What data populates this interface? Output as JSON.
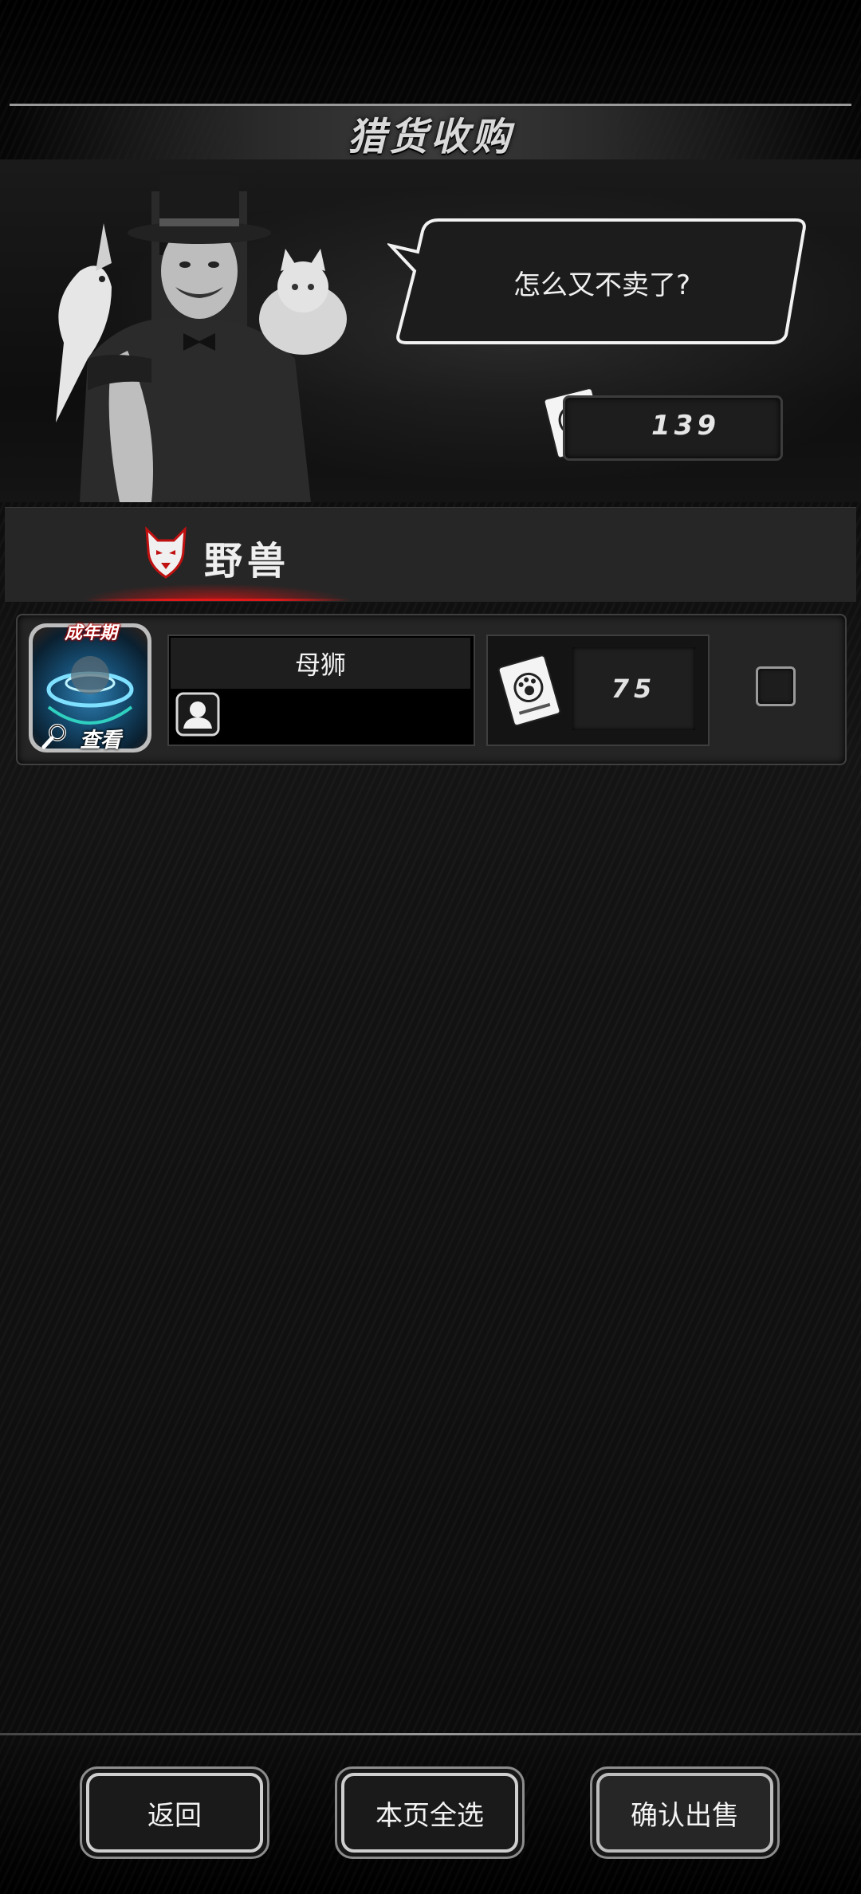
{
  "header": {
    "title": "猎货收购"
  },
  "merchant": {
    "speech": "怎么又不卖了?",
    "currency": "139"
  },
  "category": {
    "label": "野兽"
  },
  "items": [
    {
      "stage_tag": "成年期",
      "view_label": "查看",
      "name": "母狮",
      "price": "75",
      "selected": false
    }
  ],
  "buttons": {
    "back": "返回",
    "select_all": "本页全选",
    "confirm_sell": "确认出售"
  },
  "colors": {
    "accent_red": "#e01818",
    "panel": "#252525",
    "background": "#0b0b0b"
  },
  "icons": [
    "wolf-icon",
    "paw-card-icon",
    "person-icon",
    "magnify-icon"
  ]
}
